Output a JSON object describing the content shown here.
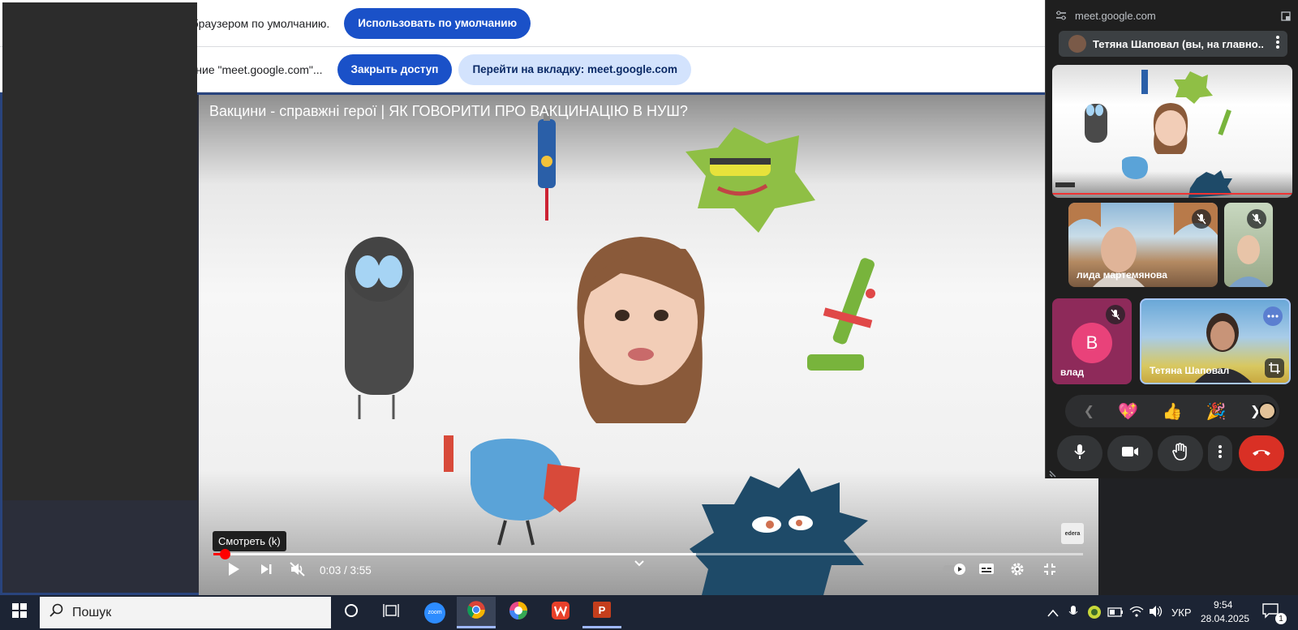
{
  "infobar_default": {
    "message": "Google Chrome не является браузером по умолчанию.",
    "button": "Использовать по умолчанию"
  },
  "infobar_share": {
    "message": "Отправка вкладки в приложение \"meet.google.com\"...",
    "stop_button": "Закрыть доступ",
    "switch_button": "Перейти на вкладку: meet.google.com"
  },
  "video": {
    "title": "Вакцини - справжні герої | ЯК ГОВОРИТИ ПРО ВАКЦИНАЦІЮ В НУШ?",
    "tooltip": "Смотреть (k)",
    "time": "0:03 / 3:55",
    "progress_played": 0.013,
    "progress_buffered": 0.555,
    "logo_text": "edera"
  },
  "meet": {
    "url": "meet.google.com",
    "presenter": "Тетяна Шаповал (вы, на главно...",
    "participants": [
      {
        "name": "лида мартемянова",
        "muted": true
      },
      {
        "name": "",
        "muted": true
      },
      {
        "name": "влад",
        "initial": "В",
        "muted": true
      },
      {
        "name": "Тетяна Шаповал",
        "muted": false
      }
    ],
    "reactions": [
      "💖",
      "👍",
      "🎉"
    ]
  },
  "taskbar": {
    "search_label": "Пошук",
    "lang": "УКР",
    "time": "9:54",
    "date": "28.04.2025",
    "notifications": "1",
    "zoom_label": "zoom"
  },
  "colors": {
    "primary": "#1a51c8",
    "end_call": "#d93025",
    "taskbar": "#1c2434"
  }
}
